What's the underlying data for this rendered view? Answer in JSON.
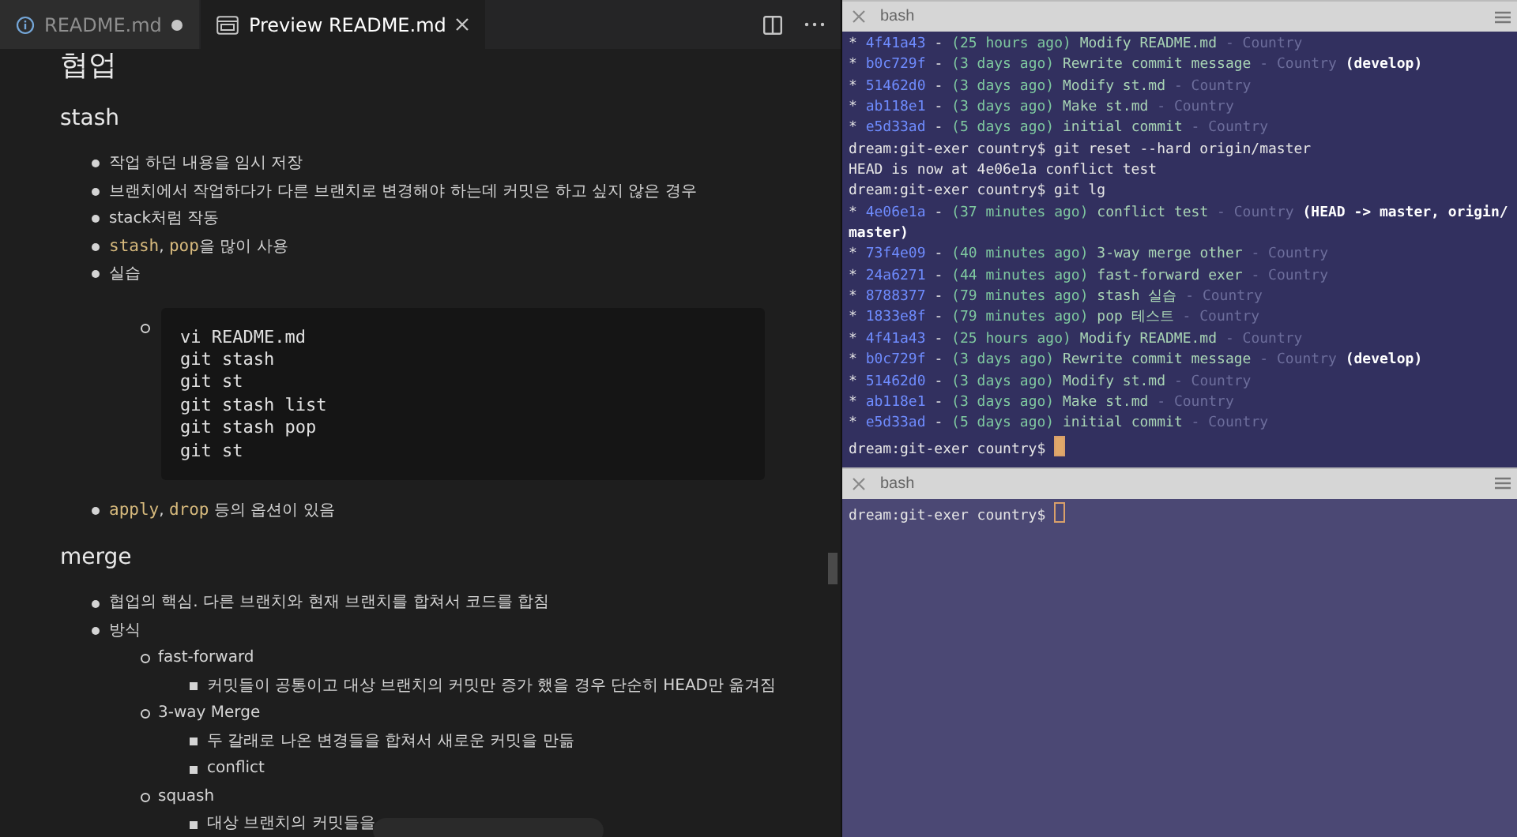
{
  "editor": {
    "tabs": [
      {
        "label": "README.md",
        "kind": "file",
        "selected": false,
        "modified": true
      },
      {
        "label": "Preview README.md",
        "kind": "preview",
        "selected": true,
        "modified": false
      }
    ],
    "title": "협업",
    "sections": [
      {
        "title": "stash",
        "items": [
          {
            "kind": "text",
            "parts": [
              {
                "kind": "plain",
                "text": "작업 하던 내용을 임시 저장"
              }
            ]
          },
          {
            "kind": "text",
            "parts": [
              {
                "kind": "plain",
                "text": "브랜치에서 작업하다가 다른 브랜치로 변경해야 하는데 커밋은 하고 싶지 않은 경우"
              }
            ]
          },
          {
            "kind": "text",
            "parts": [
              {
                "kind": "plain",
                "text": "stack처럼 작동"
              }
            ]
          },
          {
            "kind": "text",
            "parts": [
              {
                "kind": "code",
                "text": "stash"
              },
              {
                "kind": "plain",
                "text": ", "
              },
              {
                "kind": "code",
                "text": "pop"
              },
              {
                "kind": "plain",
                "text": "을 많이 사용"
              }
            ]
          },
          {
            "kind": "text",
            "parts": [
              {
                "kind": "plain",
                "text": "실습"
              }
            ],
            "children": [
              {
                "kind": "code_block",
                "lines": [
                  "vi README.md",
                  "git stash",
                  "git st",
                  "git stash list",
                  "git stash pop",
                  "git st"
                ]
              }
            ]
          },
          {
            "kind": "text",
            "parts": [
              {
                "kind": "code",
                "text": "apply"
              },
              {
                "kind": "plain",
                "text": ", "
              },
              {
                "kind": "code",
                "text": "drop"
              },
              {
                "kind": "plain",
                "text": " 등의 옵션이 있음"
              }
            ]
          }
        ]
      },
      {
        "title": "merge",
        "items": [
          {
            "kind": "text",
            "parts": [
              {
                "kind": "plain",
                "text": "협업의 핵심. 다른 브랜치와 현재 브랜치를 합쳐서 코드를 합침"
              }
            ]
          },
          {
            "kind": "text",
            "parts": [
              {
                "kind": "plain",
                "text": "방식"
              }
            ],
            "children": [
              {
                "kind": "text",
                "parts": [
                  {
                    "kind": "plain",
                    "text": "fast-forward"
                  }
                ],
                "children": [
                  {
                    "kind": "text",
                    "parts": [
                      {
                        "kind": "plain",
                        "text": "커밋들이 공통이고 대상 브랜치의 커밋만 증가 했을 경우 단순히 HEAD만 옮겨짐"
                      }
                    ]
                  }
                ]
              },
              {
                "kind": "text",
                "parts": [
                  {
                    "kind": "plain",
                    "text": "3-way Merge"
                  }
                ],
                "children": [
                  {
                    "kind": "text",
                    "parts": [
                      {
                        "kind": "plain",
                        "text": "두 갈래로 나온 변경들을 합쳐서 새로운 커밋을 만듦"
                      }
                    ]
                  },
                  {
                    "kind": "text",
                    "parts": [
                      {
                        "kind": "plain",
                        "text": "conflict"
                      }
                    ]
                  }
                ]
              },
              {
                "kind": "text",
                "parts": [
                  {
                    "kind": "plain",
                    "text": "squash"
                  }
                ],
                "children": [
                  {
                    "kind": "text",
                    "parts": [
                      {
                        "kind": "plain",
                        "text": "대상 브랜치의 커밋들을"
                      }
                    ]
                  }
                ]
              }
            ]
          }
        ]
      }
    ]
  },
  "terminals": [
    {
      "title": "bash",
      "focused": true,
      "lines": [
        {
          "kind": "commit",
          "graph": "*",
          "hash": "4f41a43",
          "separator": "-",
          "age": "(25 hours ago)",
          "message": "Modify README.md",
          "author": "- Country"
        },
        {
          "kind": "commit",
          "graph": "*",
          "hash": "b0c729f",
          "separator": "-",
          "age": "(3 days ago)",
          "message": "Rewrite commit message",
          "author": "- Country",
          "refs": "(develop)"
        },
        {
          "kind": "commit",
          "graph": "*",
          "hash": "51462d0",
          "separator": "-",
          "age": "(3 days ago)",
          "message": "Modify st.md",
          "author": "- Country"
        },
        {
          "kind": "commit",
          "graph": "*",
          "hash": "ab118e1",
          "separator": "-",
          "age": "(3 days ago)",
          "message": "Make st.md",
          "author": "- Country"
        },
        {
          "kind": "commit",
          "graph": "*",
          "hash": "e5d33ad",
          "separator": "-",
          "age": "(5 days ago)",
          "message": "initial commit",
          "author": "- Country"
        },
        {
          "kind": "prompt",
          "prompt": "dream:git-exer country$",
          "command": "git reset --hard origin/master"
        },
        {
          "kind": "output",
          "text": "HEAD is now at 4e06e1a conflict test"
        },
        {
          "kind": "prompt",
          "prompt": "dream:git-exer country$",
          "command": "git lg"
        },
        {
          "kind": "commit",
          "graph": "*",
          "hash": "4e06e1a",
          "separator": "-",
          "age": "(37 minutes ago)",
          "message": "conflict test",
          "author": "- Country",
          "refs": "(HEAD -> master, origin/master)"
        },
        {
          "kind": "commit",
          "graph": "*",
          "hash": "73f4e09",
          "separator": "-",
          "age": "(40 minutes ago)",
          "message": "3-way merge other",
          "author": "- Country"
        },
        {
          "kind": "commit",
          "graph": "*",
          "hash": "24a6271",
          "separator": "-",
          "age": "(44 minutes ago)",
          "message": "fast-forward exer",
          "author": "- Country"
        },
        {
          "kind": "commit",
          "graph": "*",
          "hash": "8788377",
          "separator": "-",
          "age": "(79 minutes ago)",
          "message": "stash 실습",
          "author": "- Country"
        },
        {
          "kind": "commit",
          "graph": "*",
          "hash": "1833e8f",
          "separator": "-",
          "age": "(79 minutes ago)",
          "message": "pop 테스트",
          "author": "- Country"
        },
        {
          "kind": "commit",
          "graph": "*",
          "hash": "4f41a43",
          "separator": "-",
          "age": "(25 hours ago)",
          "message": "Modify README.md",
          "author": "- Country"
        },
        {
          "kind": "commit",
          "graph": "*",
          "hash": "b0c729f",
          "separator": "-",
          "age": "(3 days ago)",
          "message": "Rewrite commit message",
          "author": "- Country",
          "refs": "(develop)"
        },
        {
          "kind": "commit",
          "graph": "*",
          "hash": "51462d0",
          "separator": "-",
          "age": "(3 days ago)",
          "message": "Modify st.md",
          "author": "- Country"
        },
        {
          "kind": "commit",
          "graph": "*",
          "hash": "ab118e1",
          "separator": "-",
          "age": "(3 days ago)",
          "message": "Make st.md",
          "author": "- Country"
        },
        {
          "kind": "commit",
          "graph": "*",
          "hash": "e5d33ad",
          "separator": "-",
          "age": "(5 days ago)",
          "message": "initial commit",
          "author": "- Country"
        },
        {
          "kind": "prompt",
          "prompt": "dream:git-exer country$",
          "cursor": true
        }
      ]
    },
    {
      "title": "bash",
      "focused": false,
      "lines": [
        {
          "kind": "prompt",
          "prompt": "dream:git-exer country$",
          "cursor": true
        }
      ]
    }
  ]
}
